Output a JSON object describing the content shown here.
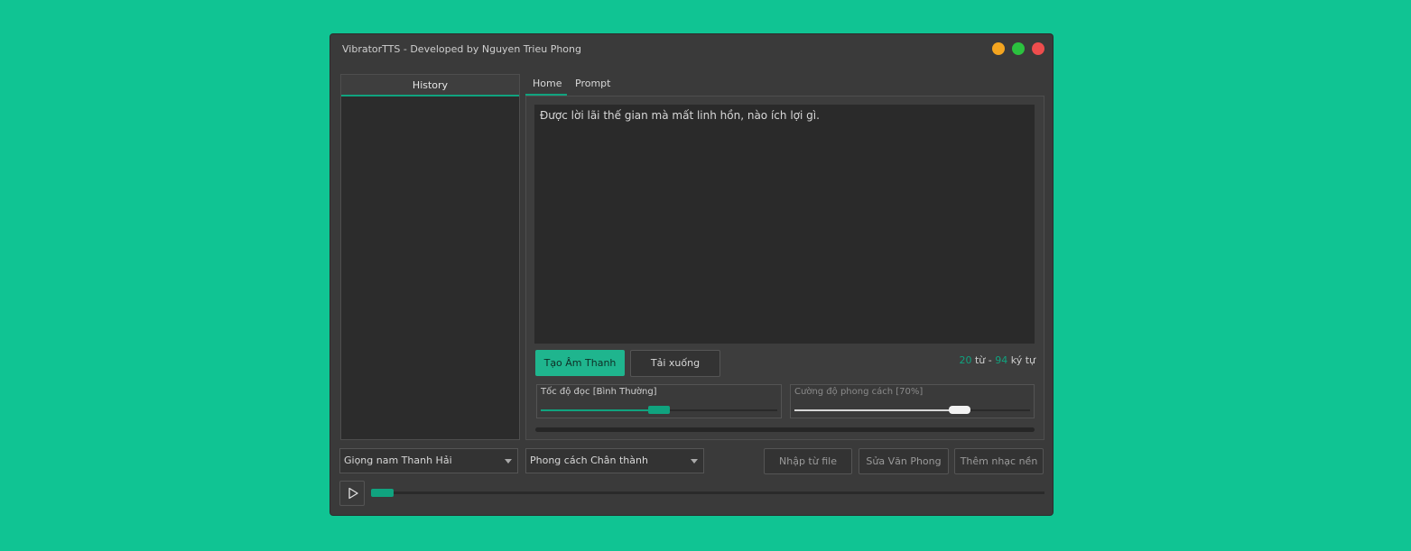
{
  "window": {
    "title": "VibratorTTS - Developed by Nguyen Trieu Phong"
  },
  "history": {
    "title": "History"
  },
  "tabs": [
    {
      "label": "Home"
    },
    {
      "label": "Prompt"
    }
  ],
  "editor": {
    "text": "Được lời lãi thế gian mà mất linh hồn, nào ích lợi gì."
  },
  "actions": {
    "generate_label": "Tạo Âm Thanh",
    "download_label": "Tải xuống"
  },
  "counter": {
    "words": "20",
    "words_unit": " từ - ",
    "chars": "94",
    "chars_unit": " ký tự"
  },
  "sliders": {
    "speed": {
      "label": "Tốc độ đọc [Bình Thường]",
      "value": 0.5
    },
    "style_strength": {
      "label": "Cường độ phong cách  [70%]",
      "value": 0.7
    }
  },
  "progress": {
    "value": 0
  },
  "voice_select": {
    "selected": "Giọng nam Thanh Hải"
  },
  "style_select": {
    "selected": "Phong cách Chân thành"
  },
  "footer_buttons": {
    "import_label": "Nhập từ file",
    "edit_label": "Sửa Văn Phong",
    "music_label": "Thêm nhạc nền"
  },
  "player": {
    "position": 0
  },
  "colors": {
    "accent": "#10a37f",
    "background": "#10c493",
    "window": "#3a3a3a"
  },
  "icons": {
    "play": "play-icon",
    "dropdown": "chevron-down-icon"
  }
}
